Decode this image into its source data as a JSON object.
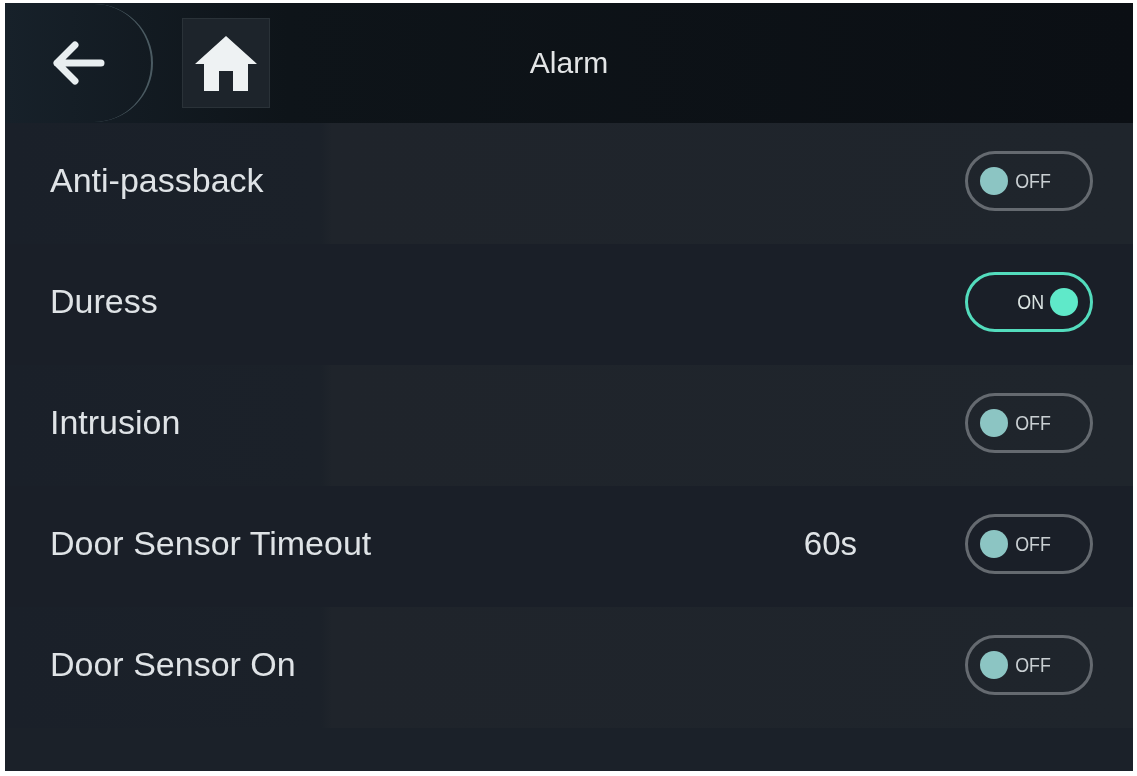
{
  "header": {
    "title": "Alarm"
  },
  "settings": [
    {
      "label": "Anti-passback",
      "on": false,
      "toggle_text": "OFF"
    },
    {
      "label": "Duress",
      "on": true,
      "toggle_text": "ON"
    },
    {
      "label": "Intrusion",
      "on": false,
      "toggle_text": "OFF"
    },
    {
      "label": "Door Sensor Timeout",
      "value": "60s",
      "on": false,
      "toggle_text": "OFF"
    },
    {
      "label": "Door Sensor On",
      "on": false,
      "toggle_text": "OFF"
    }
  ]
}
